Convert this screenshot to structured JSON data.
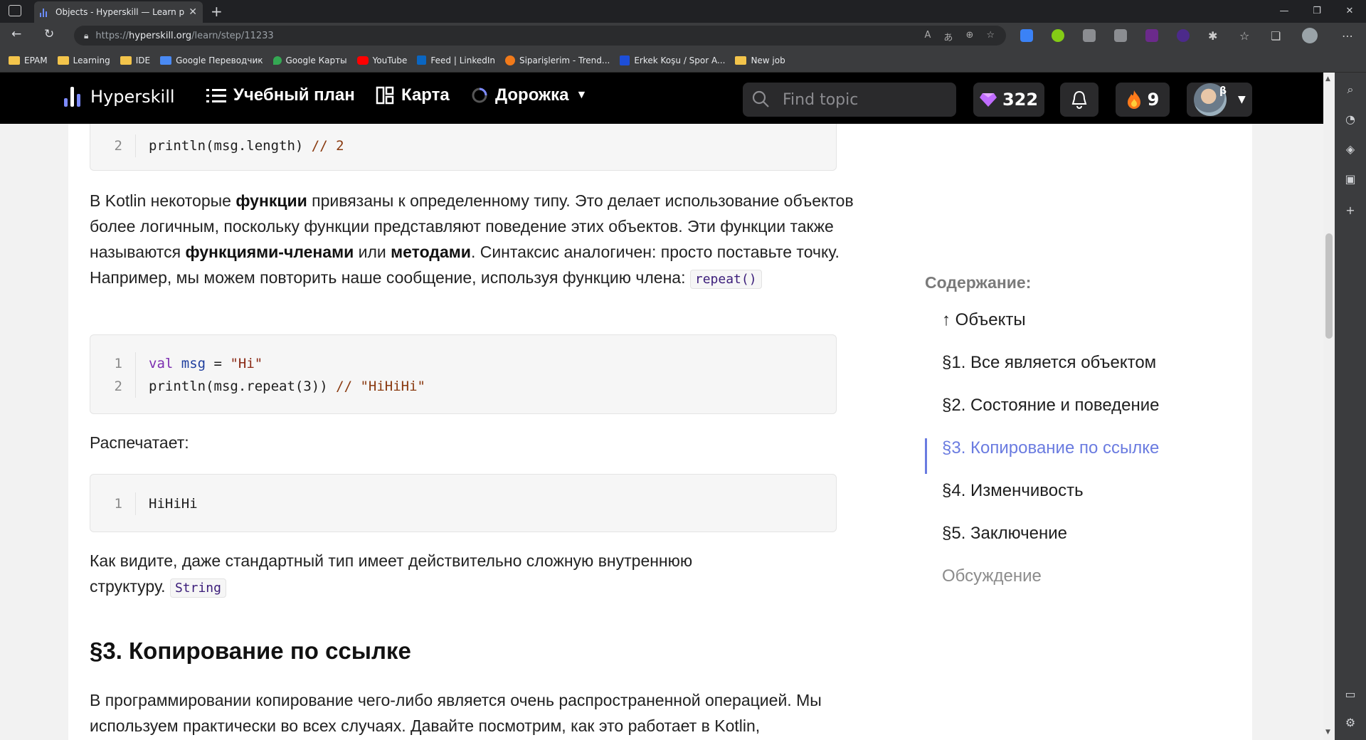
{
  "browser": {
    "tab_title": "Objects - Hyperskill — Learn pro",
    "url_scheme": "https://",
    "url_host": "hyperskill.org",
    "url_path": "/learn/step/11233",
    "bookmarks": [
      {
        "label": "EPAM",
        "color": "#f3c44b"
      },
      {
        "label": "Learning",
        "color": "#f3c44b"
      },
      {
        "label": "IDE",
        "color": "#f3c44b"
      },
      {
        "label": "Google Переводчик",
        "color": "#4a8af4"
      },
      {
        "label": "Google Карты",
        "color": "#34a853"
      },
      {
        "label": "YouTube",
        "color": "#ff0000"
      },
      {
        "label": "Feed | LinkedIn",
        "color": "#0a66c2"
      },
      {
        "label": "Siparişlerim - Trend...",
        "color": "#f27a1a"
      },
      {
        "label": "Erkek Koşu / Spor A...",
        "color": "#1d4ed8"
      },
      {
        "label": "New job",
        "color": "#f3c44b"
      }
    ]
  },
  "site": {
    "logo_text": "Hyperskill",
    "nav": {
      "study_plan": "Учебный план",
      "map": "Карта",
      "track": "Дорожка"
    },
    "search_placeholder": "Find topic",
    "gems": "322",
    "streak": "9",
    "beta": "β"
  },
  "article": {
    "code1": {
      "line_no": "2",
      "code": "println(msg.length)",
      "comment": "// 2"
    },
    "para1": {
      "t1": "В Kotlin некоторые ",
      "b1": "функции",
      "t2": " привязаны к определенному типу. Это делает использование объектов более логичным, поскольку функции представляют поведение этих объектов. Эти функции также называются ",
      "b2": "функциями-членами",
      "t3": " или ",
      "b3": "методами",
      "t4": ". Синтаксис аналогичен: просто поставьте точку. Например, мы можем повторить наше сообщение, используя функцию члена: ",
      "code": "repeat()"
    },
    "code2": {
      "l1_no": "1",
      "l1_kw": "val",
      "l1_id": "msg",
      "l1_eq": " = ",
      "l1_str": "\"Hi\"",
      "l2_no": "2",
      "l2_code": "println(msg.repeat(",
      "l2_num": "3",
      "l2_close": ")) ",
      "l2_comment": "// \"HiHiHi\""
    },
    "prints_label": "Распечатает:",
    "code3": {
      "line_no": "1",
      "code": "HiHiHi"
    },
    "para2": {
      "text": "Как видите, даже стандартный тип имеет действительно сложную внутреннюю структуру.",
      "code": "String"
    },
    "heading": "§3. Копирование по ссылке",
    "para3": "В программировании копирование чего-либо является очень распространенной операцией. Мы используем практически во всех случаях. Давайте посмотрим, как это работает в Kotlin,"
  },
  "toc": {
    "title": "Содержание:",
    "items": [
      {
        "label": "↑ Объекты",
        "state": "normal"
      },
      {
        "label": "§1. Все является объектом",
        "state": "normal"
      },
      {
        "label": "§2. Состояние и поведение",
        "state": "normal"
      },
      {
        "label": "§3. Копирование по ссылке",
        "state": "active"
      },
      {
        "label": "§4. Изменчивость",
        "state": "normal"
      },
      {
        "label": "§5. Заключение",
        "state": "normal"
      },
      {
        "label": "Обсуждение",
        "state": "muted"
      }
    ]
  },
  "colors": {
    "accent": "#6a7be0",
    "nav_bg": "#000000",
    "gem": "#c06cff",
    "fire": "#ff7a1a"
  }
}
